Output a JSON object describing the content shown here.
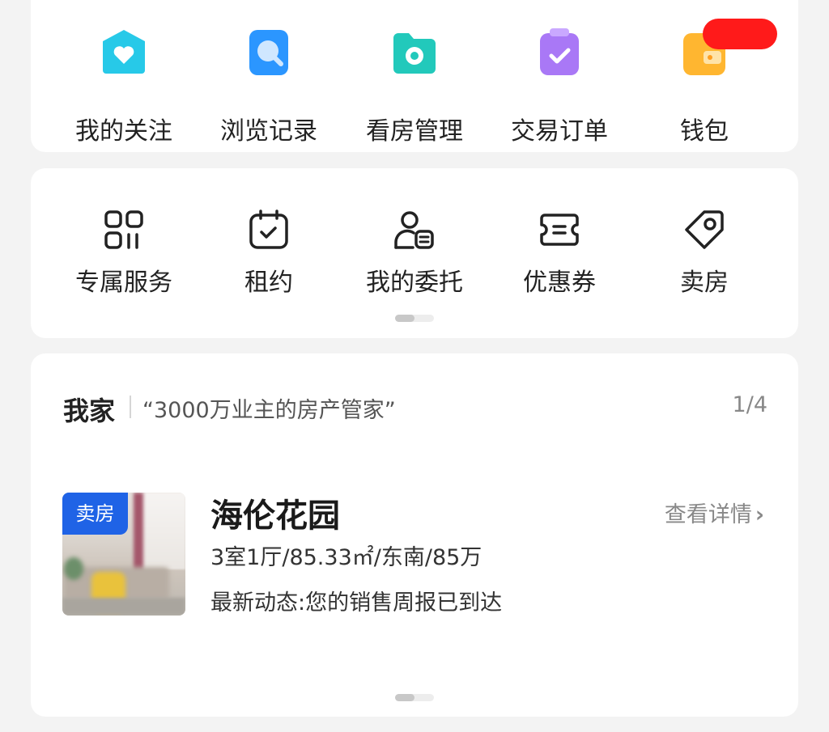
{
  "top_tiles": [
    {
      "label": "我的关注",
      "icon": "heart-house-icon",
      "color": "#27c9e8"
    },
    {
      "label": "浏览记录",
      "icon": "search-history-icon",
      "color": "#2b96ff"
    },
    {
      "label": "看房管理",
      "icon": "camera-folder-icon",
      "color": "#22c9bb"
    },
    {
      "label": "交易订单",
      "icon": "clipboard-check-icon",
      "color": "#a978f6"
    },
    {
      "label": "钱包",
      "icon": "wallet-icon",
      "color": "#ffb630"
    }
  ],
  "service_tiles": [
    {
      "label": "专属服务",
      "icon": "grid-apps-icon"
    },
    {
      "label": "租约",
      "icon": "calendar-check-icon"
    },
    {
      "label": "我的委托",
      "icon": "person-document-icon"
    },
    {
      "label": "优惠券",
      "icon": "coupon-ticket-icon"
    },
    {
      "label": "卖房",
      "icon": "price-tag-icon"
    }
  ],
  "home": {
    "title": "我家",
    "slogan": "“3000万业主的房产管家”",
    "page_indicator": "1/4",
    "listing": {
      "tag": "卖房",
      "name": "海伦花园",
      "spec": "3室1厅/85.33㎡/东南/85万",
      "news": "最新动态:您的销售周报已到达",
      "detail_link": "查看详情",
      "detail_chevron": "›"
    }
  }
}
